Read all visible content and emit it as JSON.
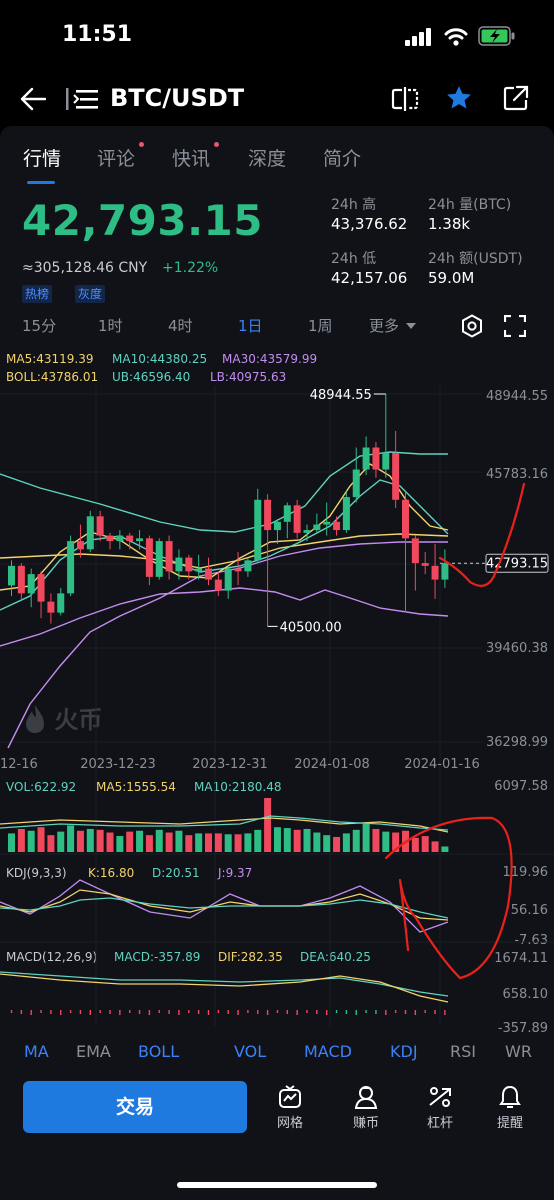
{
  "status_bar": {
    "time": "11:51"
  },
  "header": {
    "title": "BTC/USDT"
  },
  "tabs": [
    {
      "label": "行情",
      "active": true
    },
    {
      "label": "评论",
      "dot": true
    },
    {
      "label": "快讯",
      "dot": true
    },
    {
      "label": "深度"
    },
    {
      "label": "简介"
    }
  ],
  "ticker": {
    "price": "42,793.15",
    "cny": "≈305,128.46 CNY",
    "change": "+1.22%",
    "badges": [
      "热榜",
      "灰度"
    ],
    "high_label": "24h 高",
    "high": "43,376.62",
    "low_label": "24h 低",
    "low": "42,157.06",
    "vol_btc_label": "24h 量(BTC)",
    "vol_btc": "1.38k",
    "vol_usdt_label": "24h 额(USDT)",
    "vol_usdt": "59.0M"
  },
  "periods": [
    "15分",
    "1时",
    "4时",
    "1日",
    "1周",
    "更多"
  ],
  "active_period": "1日",
  "indicators": {
    "ma5": "MA5:43119.39",
    "ma10": "MA10:44380.25",
    "ma30": "MA30:43579.99",
    "boll": "BOLL:43786.01",
    "ub": "UB:46596.40",
    "lb": "LB:40975.63"
  },
  "watermark": "火币",
  "vol_labels": {
    "vol": "VOL:622.92",
    "ma5": "MA5:1555.54",
    "ma10": "MA10:2180.48"
  },
  "kdj_labels": {
    "name": "KDJ(9,3,3)",
    "k": "K:16.80",
    "d": "D:20.51",
    "j": "J:9.37"
  },
  "macd_labels": {
    "name": "MACD(12,26,9)",
    "macd": "MACD:-357.89",
    "dif": "DIF:282.35",
    "dea": "DEA:640.25"
  },
  "indicator_tabs": [
    "MA",
    "EMA",
    "BOLL",
    "VOL",
    "MACD",
    "KDJ",
    "RSI",
    "WR"
  ],
  "bottom_bar": {
    "trade": "交易",
    "grid": "网格",
    "earn": "赚币",
    "leverage": "杠杆",
    "alert": "提醒"
  },
  "colors": {
    "up": "#2ebd85",
    "down": "#f0485c",
    "accent": "#3b82f6"
  },
  "chart_data": {
    "type": "candlestick",
    "price_axis_ticks": [
      "48944.55",
      "45783.16",
      "42793.15",
      "39460.38",
      "36298.99"
    ],
    "date_ticks": [
      "12-16",
      "2023-12-23",
      "2023-12-31",
      "2024-01-08",
      "2024-01-16"
    ],
    "last_price": "42793.15",
    "annotations": {
      "high": "48944.55",
      "low": "40500.00"
    },
    "ylim": [
      36298.99,
      48944.55
    ],
    "candles": [
      [
        41990,
        42700,
        41600,
        42900
      ],
      [
        42700,
        41700,
        41500,
        42800
      ],
      [
        41700,
        42400,
        41200,
        42600
      ],
      [
        42400,
        41400,
        40800,
        42500
      ],
      [
        41400,
        41000,
        40600,
        41700
      ],
      [
        41000,
        41700,
        40900,
        41900
      ],
      [
        41700,
        43600,
        41600,
        43800
      ],
      [
        43600,
        43300,
        43000,
        44200
      ],
      [
        43300,
        44500,
        43200,
        44700
      ],
      [
        44500,
        43800,
        43600,
        44700
      ],
      [
        43800,
        43600,
        43300,
        43900
      ],
      [
        43600,
        43800,
        43300,
        44000
      ],
      [
        43800,
        43600,
        43300,
        43900
      ],
      [
        43600,
        43700,
        43300,
        44000
      ],
      [
        43700,
        42300,
        42000,
        43800
      ],
      [
        42300,
        43600,
        42200,
        43700
      ],
      [
        43600,
        42500,
        42200,
        43800
      ],
      [
        42500,
        43000,
        42200,
        43300
      ],
      [
        43000,
        42500,
        42200,
        43100
      ],
      [
        42500,
        42600,
        42200,
        43100
      ],
      [
        42600,
        42200,
        42000,
        43000
      ],
      [
        42200,
        41800,
        41600,
        42500
      ],
      [
        41800,
        42600,
        41500,
        42700
      ],
      [
        42600,
        42500,
        42000,
        43200
      ],
      [
        42500,
        42900,
        42300,
        43000
      ],
      [
        42900,
        45100,
        42800,
        45500
      ],
      [
        45100,
        44000,
        40500,
        45300
      ],
      [
        44000,
        44300,
        43500,
        44400
      ],
      [
        44300,
        44900,
        43700,
        45000
      ],
      [
        44900,
        43900,
        43700,
        45100
      ],
      [
        43900,
        44000,
        43600,
        44200
      ],
      [
        44000,
        44200,
        43900,
        44600
      ],
      [
        44200,
        44300,
        43800,
        45000
      ],
      [
        44300,
        44000,
        43800,
        44500
      ],
      [
        44000,
        45200,
        43900,
        45400
      ],
      [
        45200,
        46200,
        45000,
        47000
      ],
      [
        46200,
        47000,
        46000,
        47400
      ],
      [
        47000,
        46200,
        45900,
        47200
      ],
      [
        46200,
        46800,
        45900,
        48944.55
      ],
      [
        46800,
        45100,
        44800,
        47600
      ],
      [
        45100,
        43700,
        41000,
        45400
      ],
      [
        43700,
        42800,
        41800,
        43800
      ],
      [
        42800,
        42700,
        42400,
        43200
      ],
      [
        42700,
        42200,
        41500,
        43500
      ],
      [
        42200,
        42800,
        41900,
        43300
      ]
    ],
    "volume": [
      2100,
      2600,
      2400,
      2800,
      1900,
      2300,
      3000,
      2400,
      2600,
      2500,
      2200,
      1800,
      2300,
      2400,
      1900,
      2500,
      2200,
      2400,
      1900,
      2100,
      2100,
      2100,
      2000,
      2000,
      2100,
      2500,
      6097.58,
      2800,
      2700,
      2500,
      2600,
      2200,
      1900,
      1700,
      2100,
      2500,
      3200,
      2600,
      2300,
      2200,
      2400,
      1600,
      1800,
      1200,
      622.92
    ],
    "vol_ylim": [
      0,
      6097.58
    ],
    "kdj_ticks": [
      "119.96",
      "56.16",
      "-7.63"
    ],
    "macd_ticks": [
      "1674.11",
      "658.10",
      "-357.89"
    ]
  }
}
